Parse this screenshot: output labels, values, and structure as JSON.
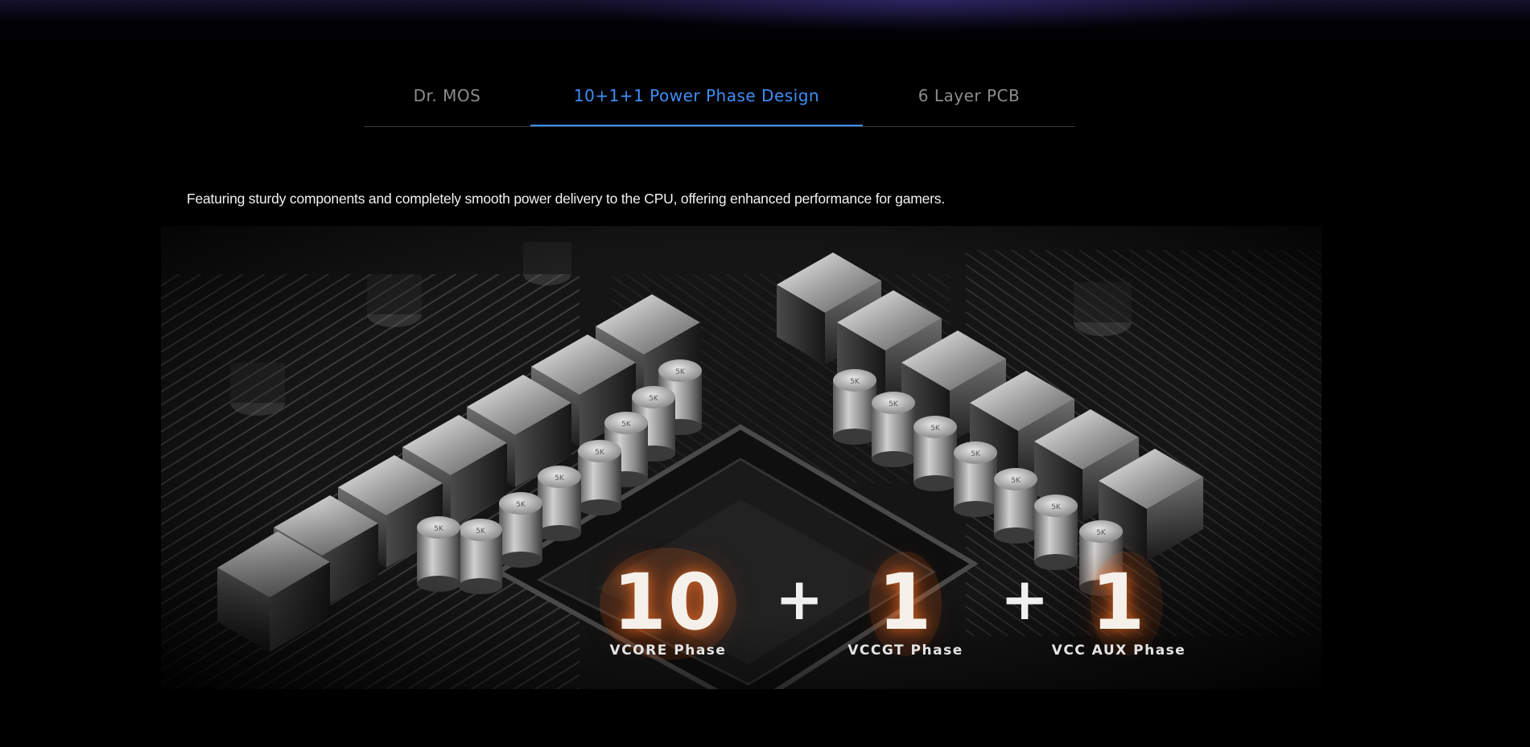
{
  "tabs": [
    {
      "label": "Dr. MOS",
      "active": false
    },
    {
      "label": "10+1+1 Power Phase Design",
      "active": true
    },
    {
      "label": "6 Layer PCB",
      "active": false
    }
  ],
  "description": "Featuring sturdy components and completely smooth power delivery to the CPU, offering enhanced performance for gamers.",
  "phases": [
    {
      "count": "10",
      "label": "VCORE Phase"
    },
    {
      "separator": "+"
    },
    {
      "count": "1",
      "label": "VCCGT Phase"
    },
    {
      "separator": "+"
    },
    {
      "count": "1",
      "label": "VCC AUX Phase"
    }
  ],
  "capacitor_marking": "5K",
  "colors": {
    "background": "#000000",
    "tab_active": "#3e8ef7",
    "tab_inactive": "#8c8c8c",
    "text": "#f2f2f2",
    "glow": "#ff7828"
  }
}
